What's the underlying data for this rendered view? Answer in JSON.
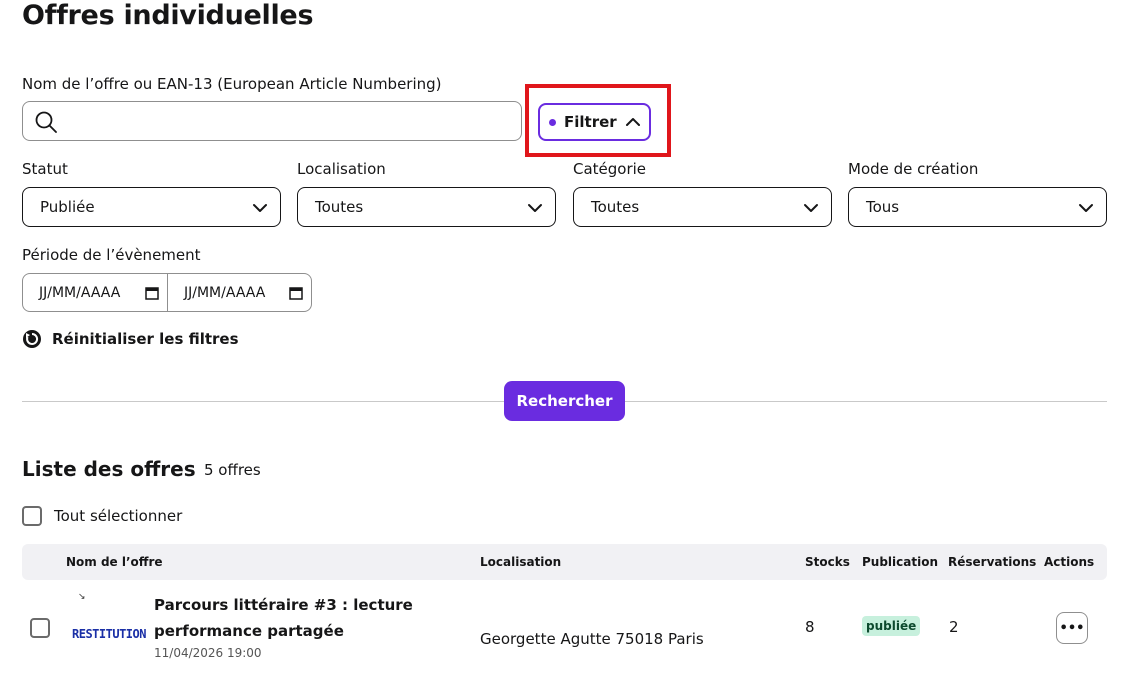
{
  "page": {
    "title": "Offres individuelles"
  },
  "search": {
    "label": "Nom de l’offre ou EAN-13 (European Article Numbering)",
    "value": "",
    "placeholder": ""
  },
  "filter_button": {
    "label": "Filtrer"
  },
  "filters": {
    "status": {
      "label": "Statut",
      "value": "Publiée"
    },
    "location": {
      "label": "Localisation",
      "value": "Toutes"
    },
    "category": {
      "label": "Catégorie",
      "value": "Toutes"
    },
    "creation_mode": {
      "label": "Mode de création",
      "value": "Tous"
    },
    "period": {
      "label": "Période de l’évènement",
      "start": "JJ/MM/AAAA",
      "end": "JJ/MM/AAAA"
    }
  },
  "reset": {
    "label": "Réinitialiser les filtres"
  },
  "search_button": {
    "label": "Rechercher"
  },
  "list": {
    "title": "Liste des offres",
    "count": "5 offres",
    "select_all": "Tout sélectionner",
    "columns": [
      "Nom de l’offre",
      "Localisation",
      "Stocks",
      "Publication",
      "Réservations",
      "Actions"
    ],
    "rows": [
      {
        "thumb_text": "RESTITUTION",
        "title": "Parcours littéraire #3 : lecture performance partagée",
        "date": "11/04/2026 19:00",
        "location": "Georgette Agutte 75018 Paris",
        "stocks": "8",
        "publication": "publiée",
        "reservations": "2",
        "actions": "•••"
      }
    ]
  },
  "colors": {
    "accent": "#6a2ce0",
    "highlight": "#e0161b",
    "badge_bg": "#c7f0dd"
  }
}
